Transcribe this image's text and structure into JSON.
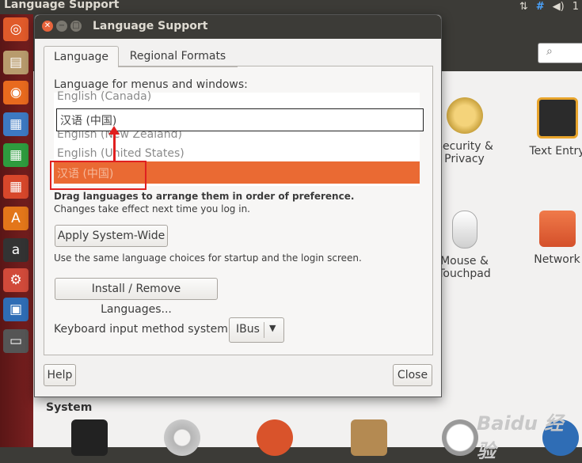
{
  "top_panel": {
    "title": "Language Support",
    "indicators": [
      "⇅",
      "#",
      "◀)",
      "1"
    ]
  },
  "launcher": {
    "items": [
      {
        "icon": "ubuntu-dash-icon",
        "glyph": "◎",
        "color": "#e05a2a"
      },
      {
        "icon": "files-icon",
        "glyph": "▤",
        "color": "#b89b6d"
      },
      {
        "icon": "firefox-icon",
        "glyph": "◉",
        "color": "#e86a1e"
      },
      {
        "icon": "writer-icon",
        "glyph": "▦",
        "color": "#3d79c2"
      },
      {
        "icon": "calc-icon",
        "glyph": "▦",
        "color": "#2e9c3e"
      },
      {
        "icon": "impress-icon",
        "glyph": "▦",
        "color": "#d7472b"
      },
      {
        "icon": "software-center-icon",
        "glyph": "A",
        "color": "#e3761a"
      },
      {
        "icon": "amazon-icon",
        "glyph": "a",
        "color": "#333"
      },
      {
        "icon": "system-settings-icon",
        "glyph": "⚙",
        "color": "#d14a3a"
      },
      {
        "icon": "language-support-icon",
        "glyph": "▣",
        "color": "#2f6db5"
      },
      {
        "icon": "drive-icon",
        "glyph": "▭",
        "color": "#555"
      }
    ]
  },
  "settings": {
    "categories": [
      {
        "label_line1": "Security &",
        "label_line2": "Privacy",
        "icon": "security-icon",
        "color": "#e8c36a"
      },
      {
        "label_line1": "Text Entry",
        "label_line2": "",
        "icon": "text-entry-icon",
        "color": "#333"
      },
      {
        "label_line1": "Mouse &",
        "label_line2": "Touchpad",
        "icon": "mouse-icon",
        "color": "#d8d8d8"
      },
      {
        "label_line1": "Network",
        "label_line2": "",
        "icon": "network-icon",
        "color": "#e0633a"
      }
    ],
    "section_label": "System"
  },
  "dialog": {
    "title": "Language Support",
    "tabs": [
      "Language",
      "Regional Formats"
    ],
    "heading": "Language for menus and windows:",
    "languages": [
      "English (Canada)",
      "English (New Zealand)",
      "English (United States)"
    ],
    "selected_language": "汉语 (中国)",
    "dragging_language": "汉语 (中国)",
    "hint_bold": "Drag languages to arrange them in order of preference.",
    "hint": "Changes take effect next time you log in.",
    "apply_button": "Apply System-Wide",
    "apply_hint": "Use the same language choices for startup and the login screen.",
    "install_button": "Install / Remove Languages...",
    "keyboard_label": "Keyboard input method system:",
    "keyboard_value": "IBus",
    "help_button": "Help",
    "close_button": "Close"
  },
  "watermark": "Baidu 经验"
}
